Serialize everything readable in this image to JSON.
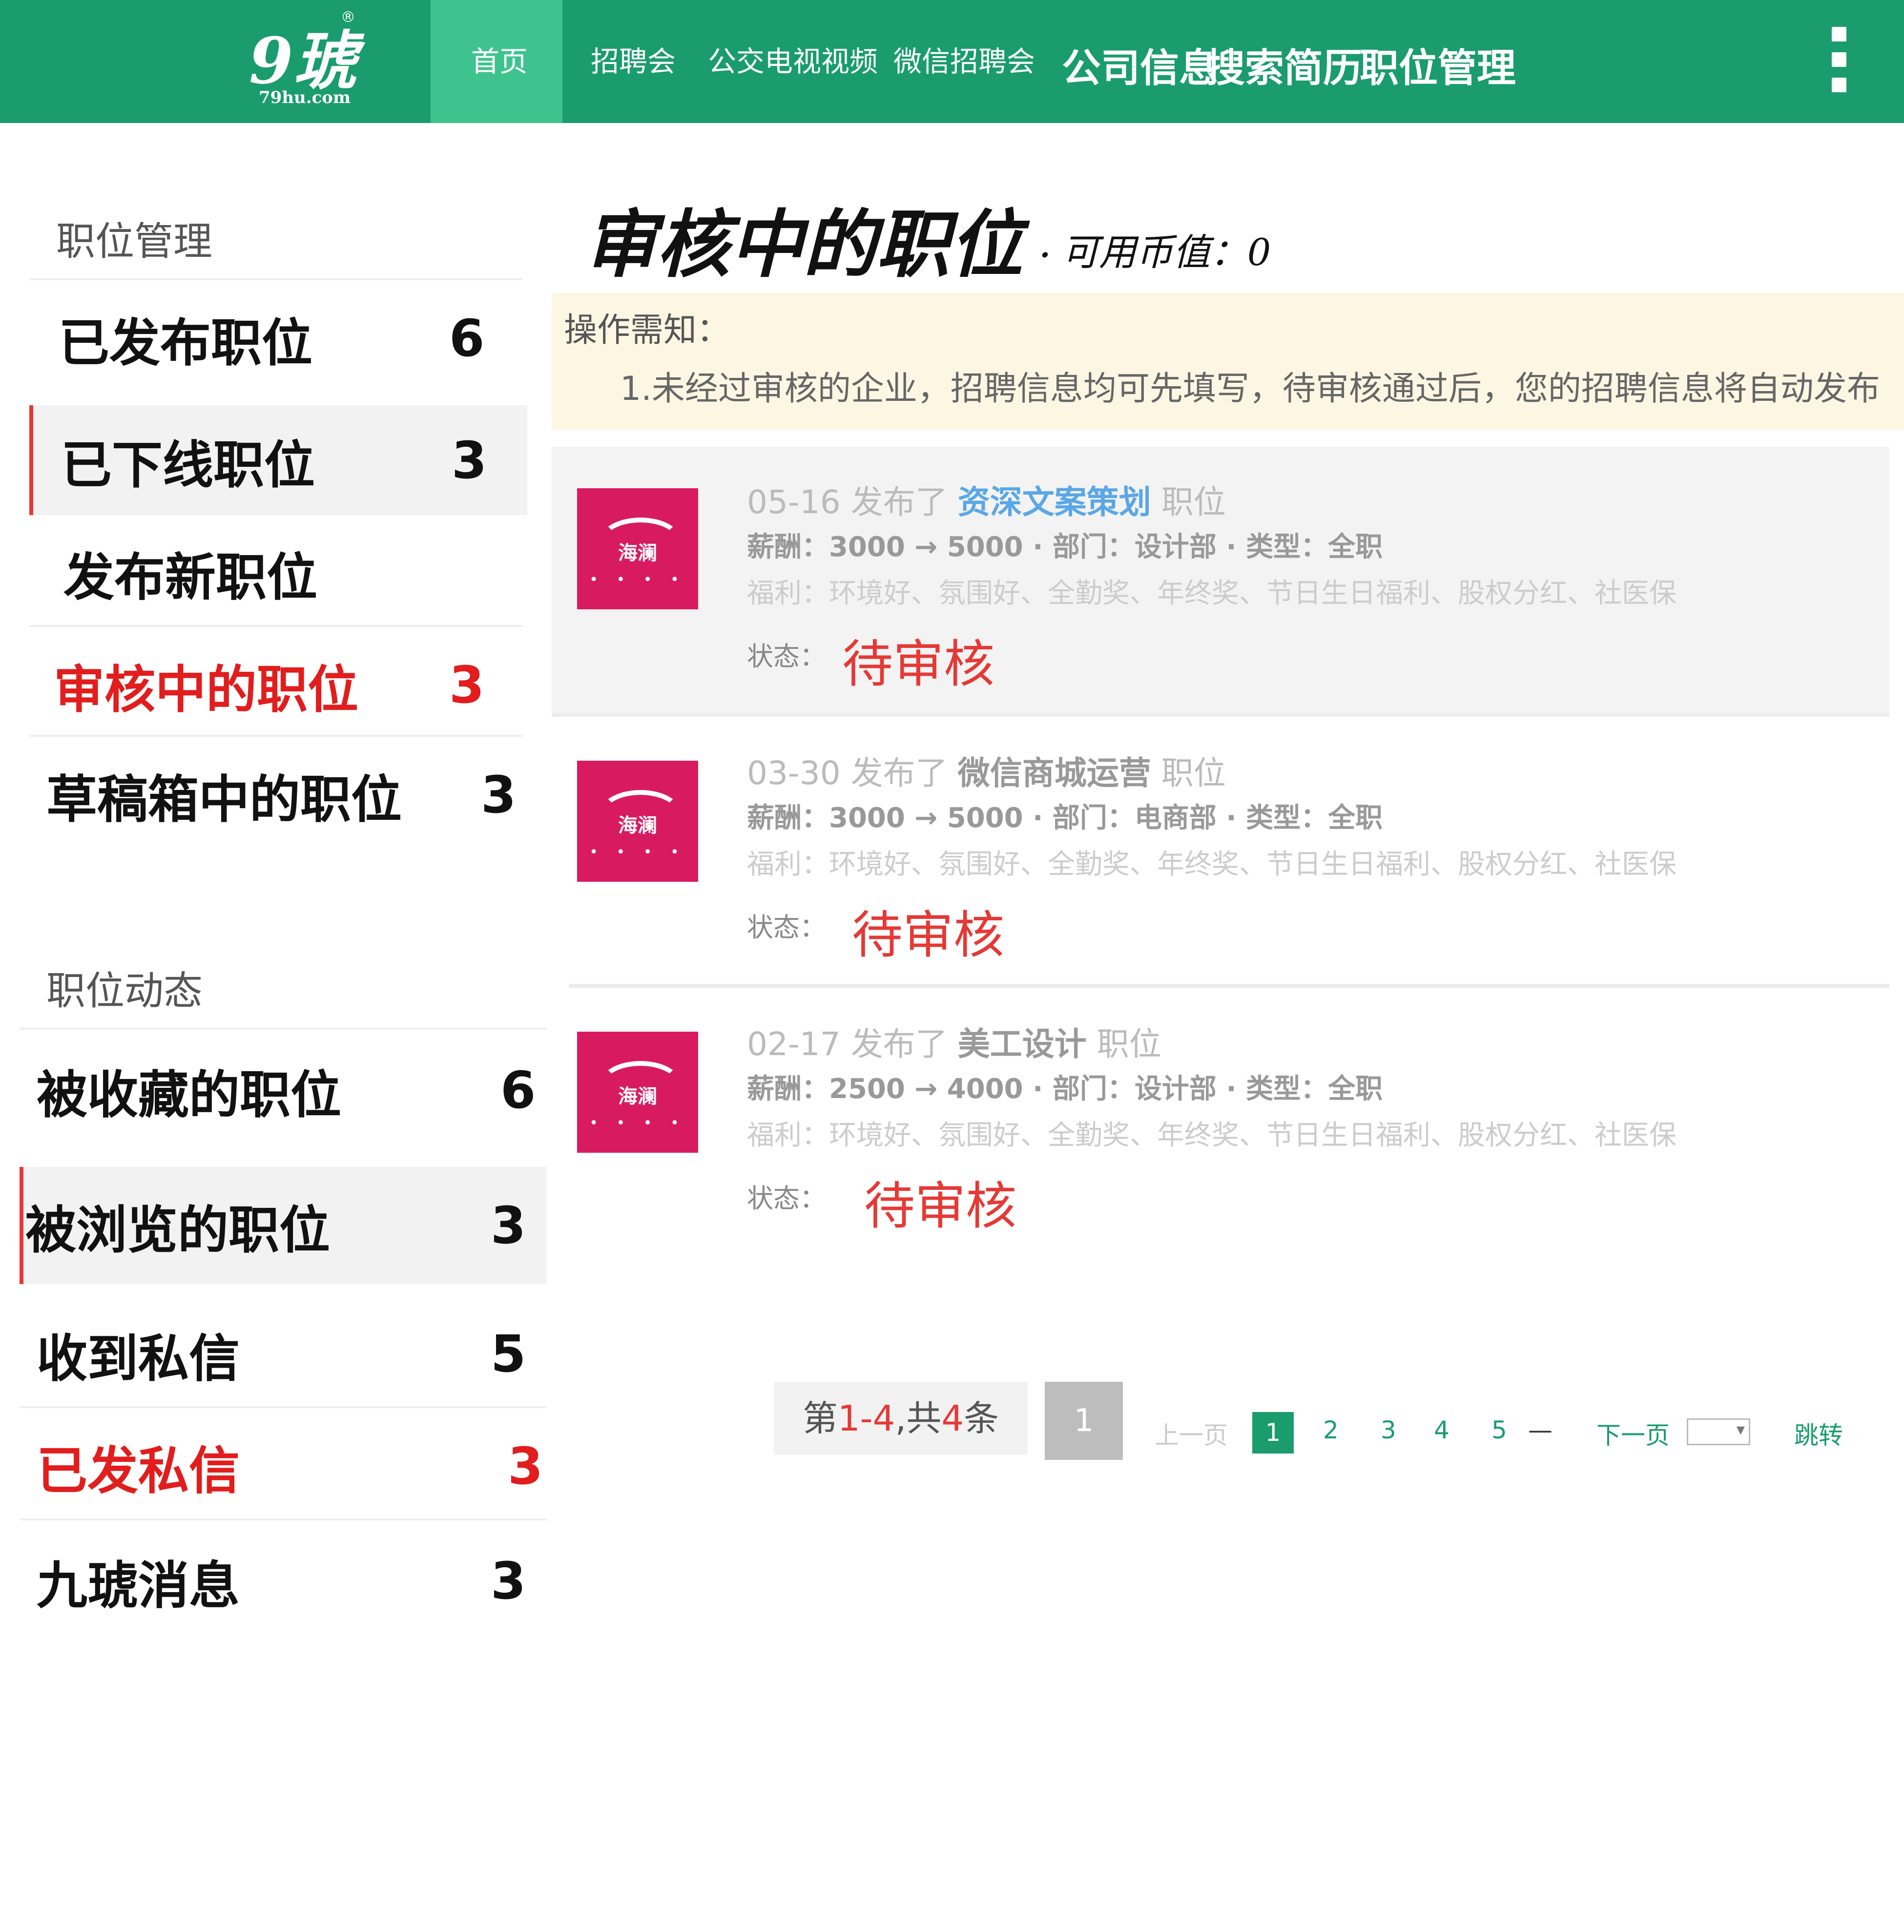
{
  "header": {
    "logo_main": "9琥",
    "logo_sub": "79hu.com",
    "nav": [
      {
        "label": "首页",
        "active": true
      },
      {
        "label": "招聘会"
      },
      {
        "label": "公交电视视频"
      },
      {
        "label": "微信招聘会"
      },
      {
        "label": "公司信息"
      },
      {
        "label": "搜索简历"
      },
      {
        "label": "职位管理"
      }
    ]
  },
  "sidebar": {
    "position_mgmt": {
      "heading": "职位管理",
      "items": [
        {
          "label": "已发布职位",
          "count": "6"
        },
        {
          "label": "已下线职位",
          "count": "3",
          "active": true
        },
        {
          "label": "发布新职位",
          "count": ""
        },
        {
          "label": "审核中的职位",
          "count": "3",
          "highlight": true
        },
        {
          "label": "草稿箱中的职位",
          "count": "3"
        }
      ]
    },
    "position_activity": {
      "heading": "职位动态",
      "items": [
        {
          "label": "被收藏的职位",
          "count": "6"
        },
        {
          "label": "被浏览的职位",
          "count": "3",
          "active": true
        },
        {
          "label": "收到私信",
          "count": "5"
        },
        {
          "label": "已发私信",
          "count": "3",
          "highlight": true
        },
        {
          "label": "九琥消息",
          "count": "3"
        }
      ]
    }
  },
  "main": {
    "title": "审核中的职位",
    "balance": "可用币值：0",
    "notice": {
      "title": "操作需知：",
      "text": "1.未经过审核的企业，招聘信息均可先填写，待审核通过后，您的招聘信息将自动发布"
    },
    "jobs": [
      {
        "date": "05-16",
        "published": "发布了",
        "name": "资深文案策划",
        "suffix": "职位",
        "salary": "薪酬：3000 → 5000 · 部门：设计部 · 类型：全职",
        "benefits": "福利：环境好、氛围好、全勤奖、年终奖、节日生日福利、股权分红、社医保",
        "status_label": "状态：",
        "status": "待审核"
      },
      {
        "date": "03-30",
        "published": "发布了",
        "name": "微信商城运营",
        "suffix": "职位",
        "salary": "薪酬：3000 → 5000 · 部门：电商部 · 类型：全职",
        "benefits": "福利：环境好、氛围好、全勤奖、年终奖、节日生日福利、股权分红、社医保",
        "status_label": "状态：",
        "status": "待审核"
      },
      {
        "date": "02-17",
        "published": "发布了",
        "name": "美工设计",
        "suffix": "职位",
        "salary": "薪酬：2500 → 4000 · 部门：设计部 · 类型：全职",
        "benefits": "福利：环境好、氛围好、全勤奖、年终奖、节日生日福利、股权分红、社医保",
        "status_label": "状态：",
        "status": "待审核"
      }
    ],
    "company_logo_text": "海澜",
    "pagination": {
      "info_prefix": "第",
      "info_range": "1-4",
      "info_mid": ",共",
      "info_total": "4",
      "info_suffix": "条",
      "current_button": "1",
      "prev": "上一页",
      "pages": [
        "1",
        "2",
        "3",
        "4",
        "5"
      ],
      "ellipsis": "—",
      "next": "下一页",
      "goto_label": "跳转"
    }
  },
  "colors": {
    "brand_green": "#1a9c6e",
    "nav_active": "#3ec38f",
    "highlight_red": "#e11d1d",
    "logo_pink": "#d81b60",
    "notice_bg": "#fdf6e3"
  },
  "icons": {
    "menu": "vertical-dots-menu-icon",
    "logo_mark": "registered-mark"
  }
}
